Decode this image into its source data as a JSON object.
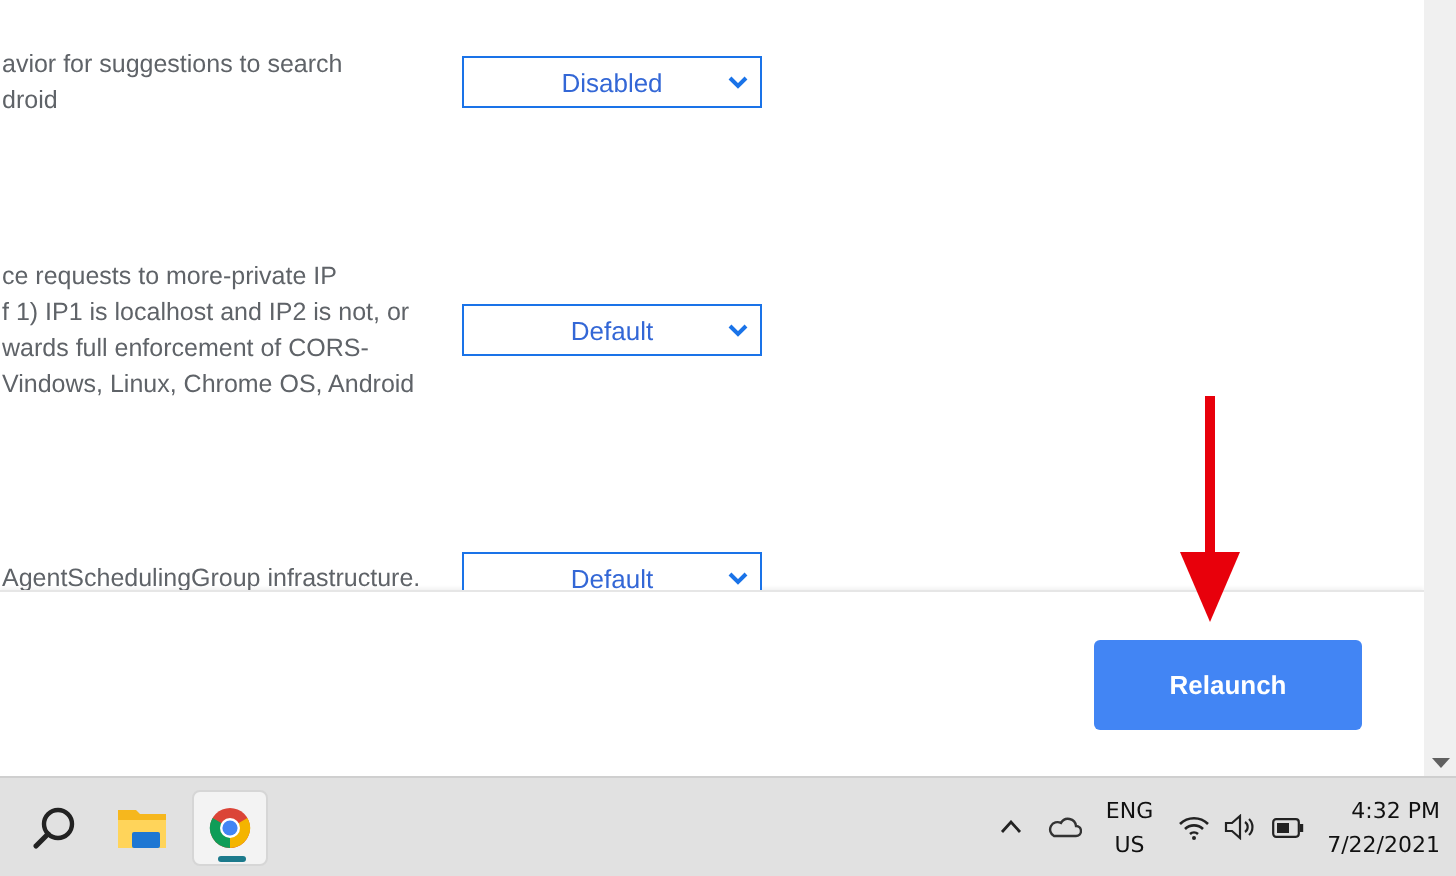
{
  "flags": [
    {
      "lines": [
        "avior for suggestions to search",
        "droid"
      ],
      "select": {
        "value": "Disabled"
      }
    },
    {
      "lines": [
        "ce requests to more-private IP",
        "f 1) IP1 is localhost and IP2 is not, or",
        "wards full enforcement of CORS-",
        "Vindows, Linux, Chrome OS, Android"
      ],
      "select": {
        "value": "Default"
      }
    },
    {
      "lines": [
        "AgentSchedulingGroup infrastructure."
      ],
      "select": {
        "value": "Default"
      }
    }
  ],
  "relaunch_button": {
    "label": "Relaunch"
  },
  "taskbar": {
    "apps": [
      {
        "kind": "search",
        "active": false
      },
      {
        "kind": "folder",
        "active": false
      },
      {
        "kind": "browser",
        "active": true
      }
    ],
    "tray": {
      "language": "ENG",
      "region": "US",
      "time": "4:32 PM",
      "date": "7/22/2021"
    }
  }
}
